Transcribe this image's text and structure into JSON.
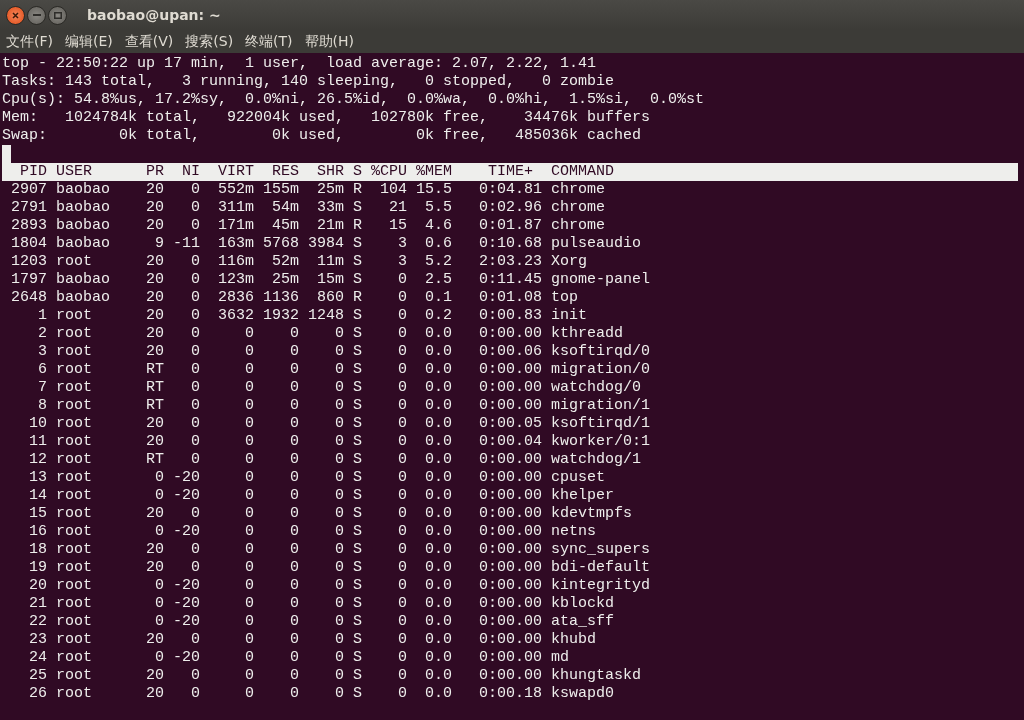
{
  "window": {
    "title": "baobao@upan: ~"
  },
  "menu": [
    "文件(F)",
    "编辑(E)",
    "查看(V)",
    "搜索(S)",
    "终端(T)",
    "帮助(H)"
  ],
  "summary": [
    "top - 22:50:22 up 17 min,  1 user,  load average: 2.07, 2.22, 1.41",
    "Tasks: 143 total,   3 running, 140 sleeping,   0 stopped,   0 zombie",
    "Cpu(s): 54.8%us, 17.2%sy,  0.0%ni, 26.5%id,  0.0%wa,  0.0%hi,  1.5%si,  0.0%st",
    "Mem:   1024784k total,   922004k used,   102780k free,    34476k buffers",
    "Swap:        0k total,        0k used,        0k free,   485036k cached"
  ],
  "table": {
    "columns": [
      "PID",
      "USER",
      "PR",
      "NI",
      "VIRT",
      "RES",
      "SHR",
      "S",
      "%CPU",
      "%MEM",
      "TIME+",
      "COMMAND"
    ],
    "rows": [
      [
        "2907",
        "baobao",
        "20",
        "0",
        "552m",
        "155m",
        "25m",
        "R",
        "104",
        "15.5",
        "0:04.81",
        "chrome"
      ],
      [
        "2791",
        "baobao",
        "20",
        "0",
        "311m",
        "54m",
        "33m",
        "S",
        "21",
        "5.5",
        "0:02.96",
        "chrome"
      ],
      [
        "2893",
        "baobao",
        "20",
        "0",
        "171m",
        "45m",
        "21m",
        "R",
        "15",
        "4.6",
        "0:01.87",
        "chrome"
      ],
      [
        "1804",
        "baobao",
        "9",
        "-11",
        "163m",
        "5768",
        "3984",
        "S",
        "3",
        "0.6",
        "0:10.68",
        "pulseaudio"
      ],
      [
        "1203",
        "root",
        "20",
        "0",
        "116m",
        "52m",
        "11m",
        "S",
        "3",
        "5.2",
        "2:03.23",
        "Xorg"
      ],
      [
        "1797",
        "baobao",
        "20",
        "0",
        "123m",
        "25m",
        "15m",
        "S",
        "0",
        "2.5",
        "0:11.45",
        "gnome-panel"
      ],
      [
        "2648",
        "baobao",
        "20",
        "0",
        "2836",
        "1136",
        "860",
        "R",
        "0",
        "0.1",
        "0:01.08",
        "top"
      ],
      [
        "1",
        "root",
        "20",
        "0",
        "3632",
        "1932",
        "1248",
        "S",
        "0",
        "0.2",
        "0:00.83",
        "init"
      ],
      [
        "2",
        "root",
        "20",
        "0",
        "0",
        "0",
        "0",
        "S",
        "0",
        "0.0",
        "0:00.00",
        "kthreadd"
      ],
      [
        "3",
        "root",
        "20",
        "0",
        "0",
        "0",
        "0",
        "S",
        "0",
        "0.0",
        "0:00.06",
        "ksoftirqd/0"
      ],
      [
        "6",
        "root",
        "RT",
        "0",
        "0",
        "0",
        "0",
        "S",
        "0",
        "0.0",
        "0:00.00",
        "migration/0"
      ],
      [
        "7",
        "root",
        "RT",
        "0",
        "0",
        "0",
        "0",
        "S",
        "0",
        "0.0",
        "0:00.00",
        "watchdog/0"
      ],
      [
        "8",
        "root",
        "RT",
        "0",
        "0",
        "0",
        "0",
        "S",
        "0",
        "0.0",
        "0:00.00",
        "migration/1"
      ],
      [
        "10",
        "root",
        "20",
        "0",
        "0",
        "0",
        "0",
        "S",
        "0",
        "0.0",
        "0:00.05",
        "ksoftirqd/1"
      ],
      [
        "11",
        "root",
        "20",
        "0",
        "0",
        "0",
        "0",
        "S",
        "0",
        "0.0",
        "0:00.04",
        "kworker/0:1"
      ],
      [
        "12",
        "root",
        "RT",
        "0",
        "0",
        "0",
        "0",
        "S",
        "0",
        "0.0",
        "0:00.00",
        "watchdog/1"
      ],
      [
        "13",
        "root",
        "0",
        "-20",
        "0",
        "0",
        "0",
        "S",
        "0",
        "0.0",
        "0:00.00",
        "cpuset"
      ],
      [
        "14",
        "root",
        "0",
        "-20",
        "0",
        "0",
        "0",
        "S",
        "0",
        "0.0",
        "0:00.00",
        "khelper"
      ],
      [
        "15",
        "root",
        "20",
        "0",
        "0",
        "0",
        "0",
        "S",
        "0",
        "0.0",
        "0:00.00",
        "kdevtmpfs"
      ],
      [
        "16",
        "root",
        "0",
        "-20",
        "0",
        "0",
        "0",
        "S",
        "0",
        "0.0",
        "0:00.00",
        "netns"
      ],
      [
        "18",
        "root",
        "20",
        "0",
        "0",
        "0",
        "0",
        "S",
        "0",
        "0.0",
        "0:00.00",
        "sync_supers"
      ],
      [
        "19",
        "root",
        "20",
        "0",
        "0",
        "0",
        "0",
        "S",
        "0",
        "0.0",
        "0:00.00",
        "bdi-default"
      ],
      [
        "20",
        "root",
        "0",
        "-20",
        "0",
        "0",
        "0",
        "S",
        "0",
        "0.0",
        "0:00.00",
        "kintegrityd"
      ],
      [
        "21",
        "root",
        "0",
        "-20",
        "0",
        "0",
        "0",
        "S",
        "0",
        "0.0",
        "0:00.00",
        "kblockd"
      ],
      [
        "22",
        "root",
        "0",
        "-20",
        "0",
        "0",
        "0",
        "S",
        "0",
        "0.0",
        "0:00.00",
        "ata_sff"
      ],
      [
        "23",
        "root",
        "20",
        "0",
        "0",
        "0",
        "0",
        "S",
        "0",
        "0.0",
        "0:00.00",
        "khubd"
      ],
      [
        "24",
        "root",
        "0",
        "-20",
        "0",
        "0",
        "0",
        "S",
        "0",
        "0.0",
        "0:00.00",
        "md"
      ],
      [
        "25",
        "root",
        "20",
        "0",
        "0",
        "0",
        "0",
        "S",
        "0",
        "0.0",
        "0:00.00",
        "khungtaskd"
      ],
      [
        "26",
        "root",
        "20",
        "0",
        "0",
        "0",
        "0",
        "S",
        "0",
        "0.0",
        "0:00.18",
        "kswapd0"
      ]
    ]
  }
}
